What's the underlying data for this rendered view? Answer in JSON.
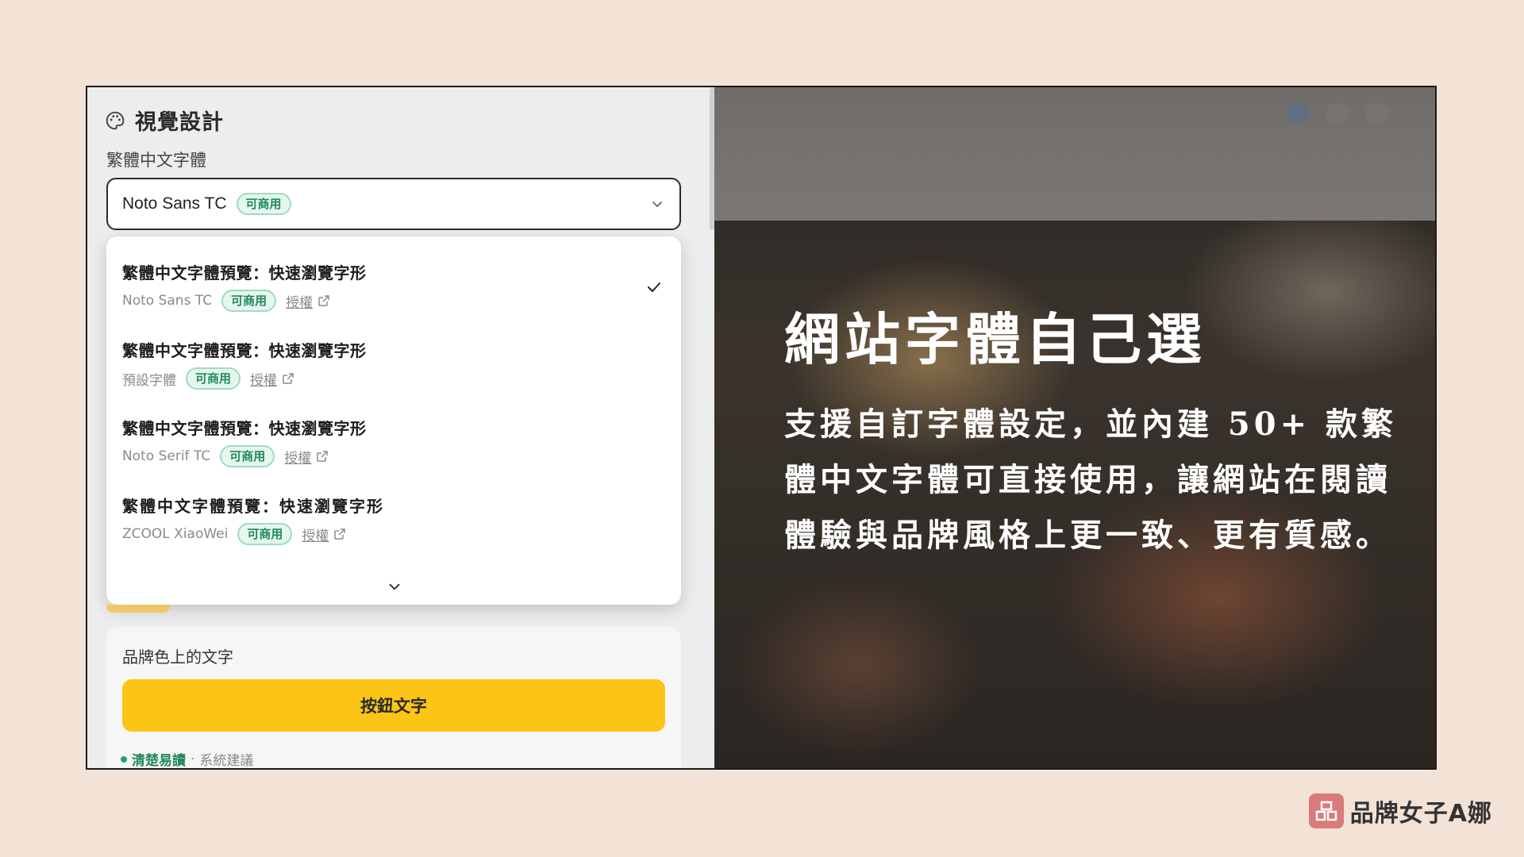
{
  "panel": {
    "title": "視覺設計",
    "font_field_label": "繁體中文字體",
    "select": {
      "value": "Noto Sans TC",
      "badge": "可商用"
    },
    "options": [
      {
        "preview": "繁體中文字體預覽：快速瀏覽字形",
        "font": "Noto Sans TC",
        "badge": "可商用",
        "license": "授權",
        "selected": true
      },
      {
        "preview": "繁體中文字體預覽：快速瀏覽字形",
        "font": "預設字體",
        "badge": "可商用",
        "license": "授權",
        "selected": false
      },
      {
        "preview": "繁體中文字體預覽：快速瀏覽字形",
        "font": "Noto Serif TC",
        "badge": "可商用",
        "license": "授權",
        "selected": false
      },
      {
        "preview": "繁體中文字體預覽：快速瀏覽字形",
        "font": "ZCOOL XiaoWei",
        "badge": "可商用",
        "license": "授權",
        "selected": false
      }
    ],
    "brand_text_card": {
      "label": "品牌色上的文字",
      "button_label": "按鈕文字",
      "hint_good": "清楚易讀",
      "hint_sep": "·",
      "hint_sub": "系統建議"
    }
  },
  "preview": {
    "headline": "網站字體自己選",
    "body": "支援自訂字體設定，並內建 50+ 款繁體中文字體可直接使用，讓網站在閱讀體驗與品牌風格上更一致、更有質感。"
  },
  "brand": {
    "name": "品牌女子A娜"
  },
  "colors": {
    "accent": "#fcc515",
    "badge_green": "#1f8a5c",
    "background": "#f3e2d6"
  }
}
